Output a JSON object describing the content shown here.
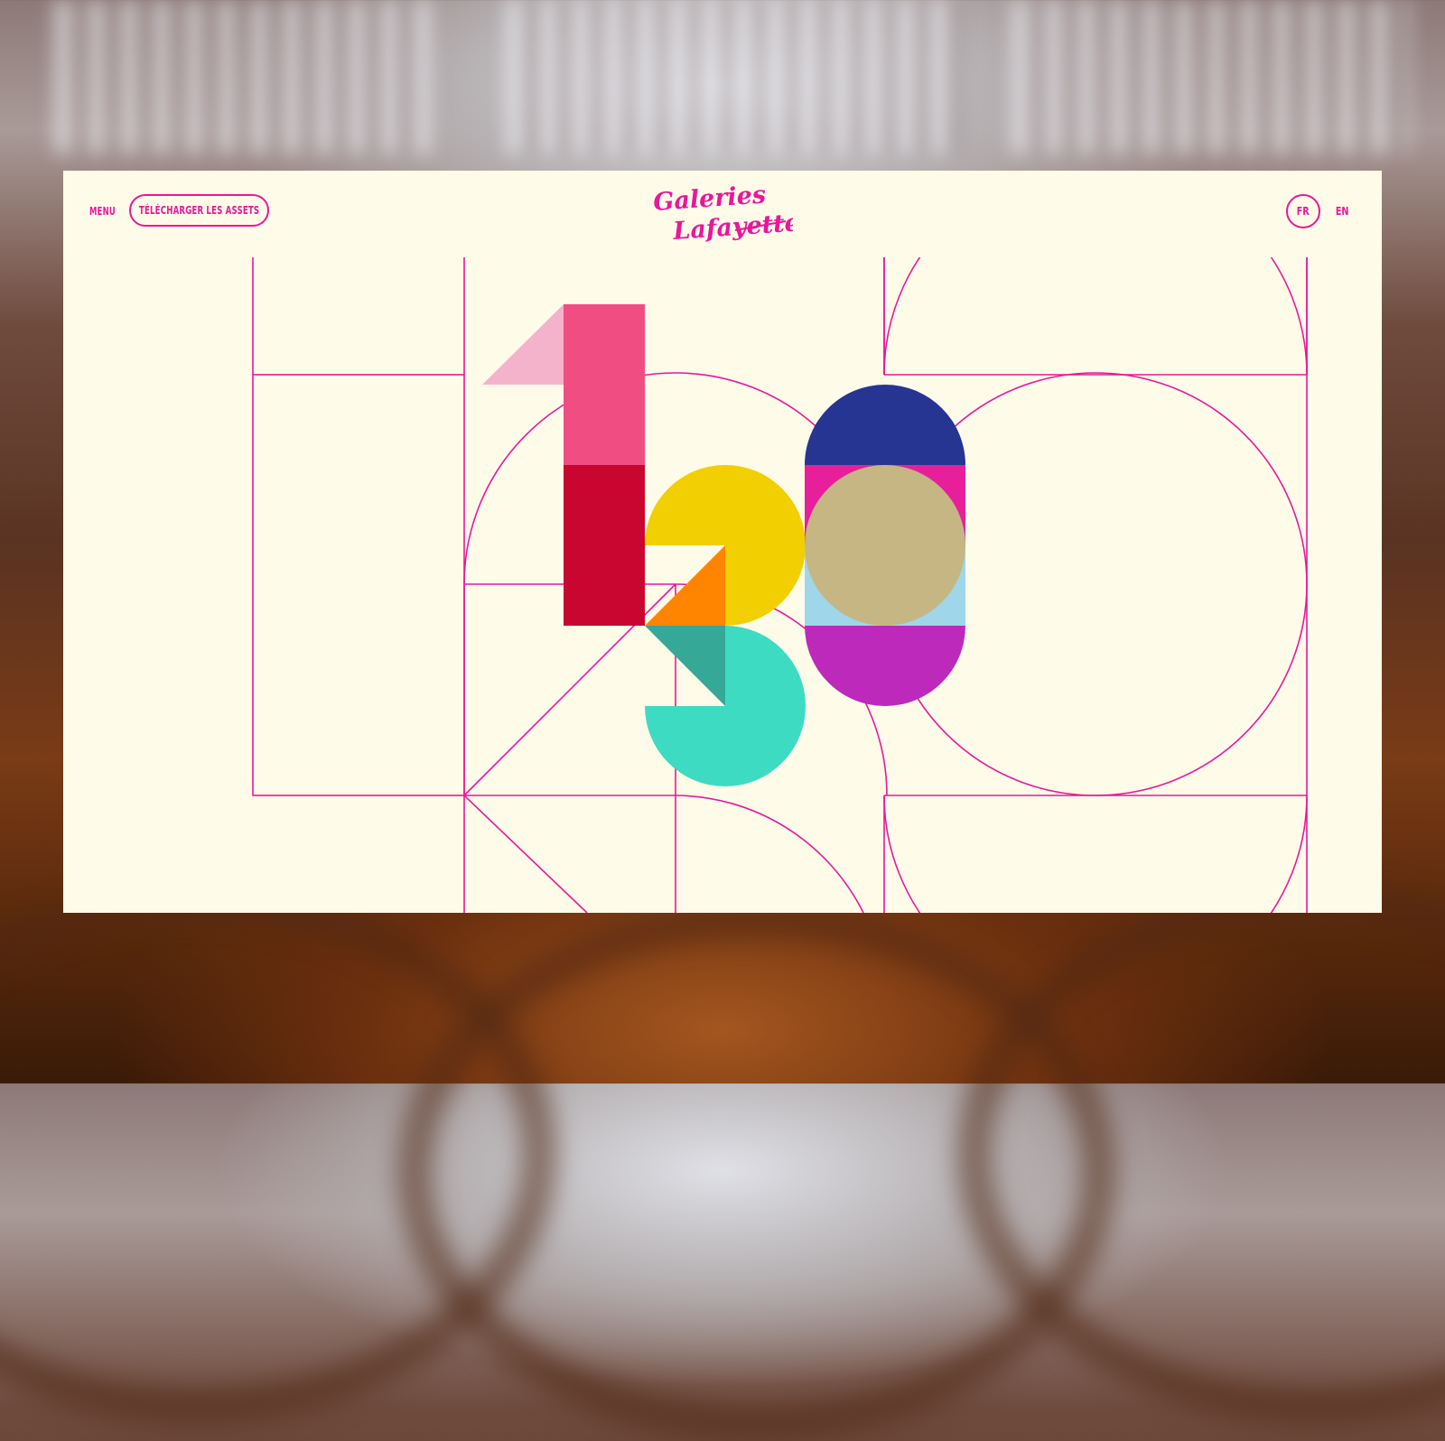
{
  "header": {
    "menu_label": "MENU",
    "assets_button_label": "TÉLÉCHARGER LES ASSETS",
    "logo_text_line1": "Galeries",
    "logo_text_line2": "Lafayette",
    "lang_fr": "FR",
    "lang_en": "EN"
  },
  "colors": {
    "page_background": "#fffbe9",
    "accent_magenta": "#e8179b",
    "pink_light": "#f5b3cb",
    "pink": "#f04e83",
    "crimson": "#c8062f",
    "yellow": "#f2cf00",
    "orange": "#ff8400",
    "teal_dark": "#35a898",
    "turquoise": "#3ddbc2",
    "navy": "#263591",
    "magenta": "#e81f9b",
    "sky_blue": "#9fd6e9",
    "sand": "#c6b683",
    "purple": "#bd29bb"
  },
  "illustration": {
    "subject": "130 anniversary geometric numerals"
  }
}
